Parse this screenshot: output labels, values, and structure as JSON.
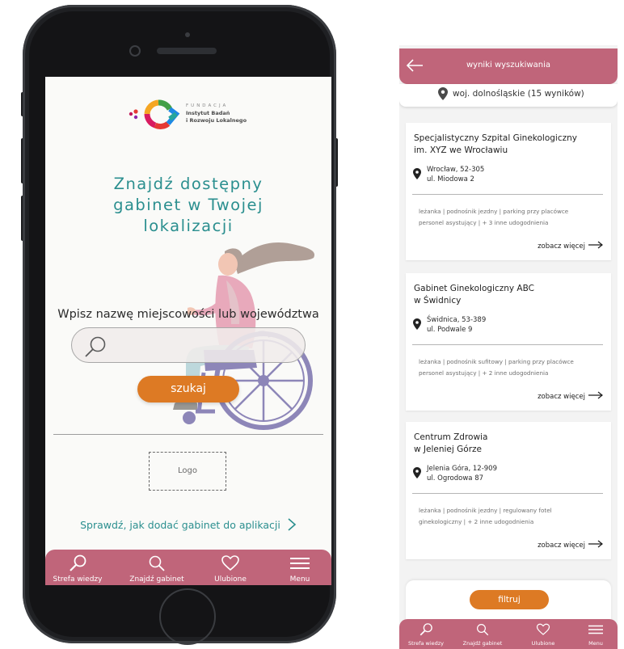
{
  "phone": {
    "logo": {
      "line1": "FUNDACJA",
      "line2": "Instytut Badań",
      "line3": "i Rozwoju Lokalnego"
    },
    "headline": [
      "Znajdź dostępny",
      "gabinet w Twojej",
      "lokalizacji"
    ],
    "search": {
      "label": "Wpisz nazwę miejscowości lub województwa",
      "value": "",
      "placeholder": ""
    },
    "search_button": "szukaj",
    "logo_placeholder": "Logo",
    "add_link": "Sprawdź, jak dodać gabinet do aplikacji",
    "tabs": [
      {
        "label": "Strefa wiedzy",
        "icon": "knowledge-magnifier-icon"
      },
      {
        "label": "Znajdź gabinet",
        "icon": "search-icon"
      },
      {
        "label": "Ulubione",
        "icon": "heart-icon"
      },
      {
        "label": "Menu",
        "icon": "hamburger-menu-icon"
      }
    ]
  },
  "results": {
    "header_title": "wyniki wyszukiwania",
    "location": "woj. dolnośląskie (15 wyników)",
    "cards": [
      {
        "name_line1": "Specjalistyczny Szpital Ginekologiczny",
        "name_line2": "im. XYZ we Wrocławiu",
        "city": "Wrocław, 52-305",
        "street": "ul. Miodowa 2",
        "features_line1": "leżanka | podnośnik jezdny | parking przy placówce",
        "features_line2": "personel asystujący | + 3 inne udogodnienia",
        "more": "zobacz więcej"
      },
      {
        "name_line1": "Gabinet Ginekologiczny ABC",
        "name_line2": "w Świdnicy",
        "city": "Świdnica, 53-389",
        "street": "ul. Podwale 9",
        "features_line1": "leżanka | podnośnik sufitowy | parking przy placówce",
        "features_line2": "personel asystujący | + 2 inne udogodnienia",
        "more": "zobacz więcej"
      },
      {
        "name_line1": "Centrum Zdrowia",
        "name_line2": "w Jeleniej Górze",
        "city": "Jelenia Góra, 12-909",
        "street": "ul. Ogrodowa 87",
        "features_line1": "leżanka | podnośnik jezdny | regulowany fotel",
        "features_line2": "ginekologiczny | + 2 inne udogodnienia",
        "more": "zobacz więcej"
      }
    ],
    "filter_button": "filtruj",
    "tabs": [
      {
        "label": "Strefa wiedzy",
        "icon": "knowledge-magnifier-icon"
      },
      {
        "label": "Znajdź gabinet",
        "icon": "search-icon"
      },
      {
        "label": "Ulubione",
        "icon": "heart-icon"
      },
      {
        "label": "Menu",
        "icon": "hamburger-menu-icon"
      }
    ]
  },
  "colors": {
    "accent_pink": "#c0657a",
    "accent_orange": "#dd7a24",
    "accent_teal": "#2b8f8f"
  }
}
